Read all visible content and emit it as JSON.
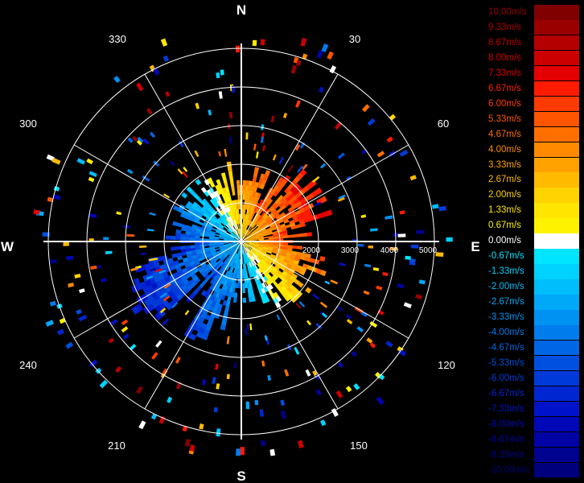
{
  "radar": {
    "compass": {
      "n": "N",
      "e": "E",
      "s": "S",
      "w": "W"
    },
    "azimuth_labels": [
      "30",
      "60",
      "120",
      "150",
      "210",
      "240",
      "300",
      "330"
    ],
    "range_labels": [
      "2000",
      "3000",
      "4000",
      "5000"
    ],
    "colors": {
      "background": "#000000",
      "grid": "#ffffff"
    }
  },
  "legend": {
    "items": [
      {
        "label": "10.00m/s",
        "color": "#800000",
        "text_color": "#9a0000"
      },
      {
        "label": "9.33m/s",
        "color": "#9a0000",
        "text_color": "#b00000"
      },
      {
        "label": "8.67m/s",
        "color": "#b40000",
        "text_color": "#c40000"
      },
      {
        "label": "8.00m/s",
        "color": "#cc0000",
        "text_color": "#d40000"
      },
      {
        "label": "7.33m/s",
        "color": "#e40000",
        "text_color": "#e00000"
      },
      {
        "label": "6.67m/s",
        "color": "#ff1a00",
        "text_color": "#ff2200"
      },
      {
        "label": "6.00m/s",
        "color": "#ff3a00",
        "text_color": "#ff3a00"
      },
      {
        "label": "5.33m/s",
        "color": "#ff5500",
        "text_color": "#ff5500"
      },
      {
        "label": "4.67m/s",
        "color": "#ff6f00",
        "text_color": "#ff6f00"
      },
      {
        "label": "4.00m/s",
        "color": "#ff8a00",
        "text_color": "#ff8a00"
      },
      {
        "label": "3.33m/s",
        "color": "#ffa200",
        "text_color": "#ffa200"
      },
      {
        "label": "2.67m/s",
        "color": "#ffbb00",
        "text_color": "#ffbb00"
      },
      {
        "label": "2.00m/s",
        "color": "#ffd300",
        "text_color": "#ffd300"
      },
      {
        "label": "1.33m/s",
        "color": "#ffe600",
        "text_color": "#ffe600"
      },
      {
        "label": "0.67m/s",
        "color": "#fff200",
        "text_color": "#fff200"
      },
      {
        "label": "0.00m/s",
        "color": "#ffffff",
        "text_color": "#ffffff"
      },
      {
        "label": "-0.67m/s",
        "color": "#00e5ff",
        "text_color": "#00e5ff"
      },
      {
        "label": "-1.33m/s",
        "color": "#00d2ff",
        "text_color": "#00d2ff"
      },
      {
        "label": "-2.00m/s",
        "color": "#00bdfc",
        "text_color": "#00bdfc"
      },
      {
        "label": "-2.67m/s",
        "color": "#00a8f8",
        "text_color": "#00a8f8"
      },
      {
        "label": "-3.33m/s",
        "color": "#0092f2",
        "text_color": "#0092f2"
      },
      {
        "label": "-4.00m/s",
        "color": "#007cec",
        "text_color": "#007cec"
      },
      {
        "label": "-4.67m/s",
        "color": "#0066e6",
        "text_color": "#0066e6"
      },
      {
        "label": "-5.33m/s",
        "color": "#0050e0",
        "text_color": "#0050e0"
      },
      {
        "label": "-6.00m/s",
        "color": "#003bda",
        "text_color": "#003bda"
      },
      {
        "label": "-6.67m/s",
        "color": "#0026d2",
        "text_color": "#0026d2"
      },
      {
        "label": "-7.33m/s",
        "color": "#0013c8",
        "text_color": "#0013c8"
      },
      {
        "label": "-8.00m/s",
        "color": "#0008b8",
        "text_color": "#0008b8"
      },
      {
        "label": "-8.67m/s",
        "color": "#0004a4",
        "text_color": "#0004a4"
      },
      {
        "label": "-9.33m/s",
        "color": "#000290",
        "text_color": "#000290"
      },
      {
        "label": "-10.00m/s",
        "color": "#00007c",
        "text_color": "#00007c"
      }
    ]
  }
}
